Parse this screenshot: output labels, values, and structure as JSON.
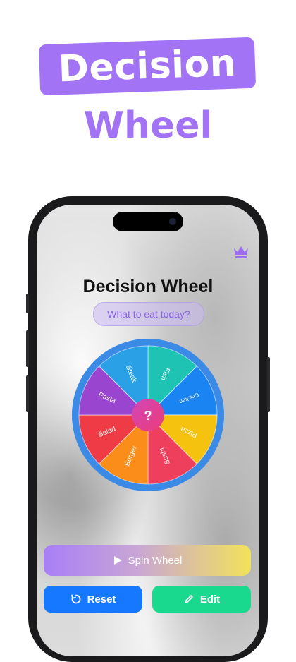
{
  "promo": {
    "title_line1": "Decision",
    "title_line2": "Wheel",
    "accent": "#a273f5"
  },
  "app": {
    "title": "Decision Wheel",
    "question": "What to eat today?",
    "premium_icon": "crown-icon",
    "center_label": "?"
  },
  "wheel": {
    "segments": [
      {
        "label": "Fish",
        "color": "#1fc3b4"
      },
      {
        "label": "Chicken",
        "color": "#1a85f2"
      },
      {
        "label": "Pizza",
        "color": "#f5c20f"
      },
      {
        "label": "Sushi",
        "color": "#ee3f5c"
      },
      {
        "label": "Burger",
        "color": "#fb8d1a"
      },
      {
        "label": "Salad",
        "color": "#ee3b45"
      },
      {
        "label": "Pasta",
        "color": "#9a45cf"
      },
      {
        "label": "Steak",
        "color": "#2aa0e6"
      }
    ],
    "rim_color": "#3b8ae6"
  },
  "buttons": {
    "spin": "Spin Wheel",
    "reset": "Reset",
    "edit": "Edit"
  }
}
